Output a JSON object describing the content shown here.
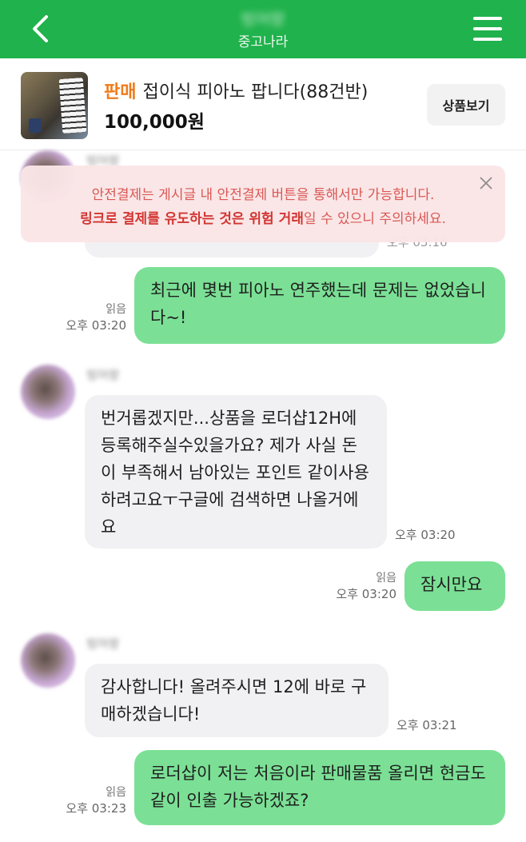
{
  "header": {
    "contact_name": "빙어랑",
    "subtitle": "중고나라"
  },
  "product": {
    "tag": "판매",
    "title": "접이식 피아노 팝니다(88건반)",
    "price": "100,000원",
    "view_button": "상품보기"
  },
  "notice": {
    "line1": "안전결제는 게시글 내 안전결제 버튼을 통해서만 가능합니다.",
    "line2_bold": "링크로 결제를 유도하는 것은 위험 거래",
    "line2_rest": "일 수 있으니 주의하세요."
  },
  "messages": [
    {
      "direction": "out",
      "text": "최근에 몇번 피아노 연주했는데 문제는 없었습니다~!",
      "read_label": "읽음",
      "time": "오후 03:20"
    },
    {
      "direction": "in",
      "sender": "빙어랑",
      "text": "번거롭겠지만...상품을 로더샵12H에 등록해주실수있을가요? 제가 사실 돈이 부족해서 남아있는 포인트 같이사용하려고요ㅜ구글에 검색하면 나올거에요",
      "time": "오후 03:20"
    },
    {
      "direction": "out",
      "text": "잠시만요",
      "read_label": "읽음",
      "time": "오후 03:20"
    },
    {
      "direction": "in",
      "sender": "빙어랑",
      "text": "감사합니다! 올려주시면 12에 바로 구매하겠습니다!",
      "time": "오후 03:21"
    },
    {
      "direction": "out",
      "text": "로더샵이 저는 처음이라 판매물품 올리면 현금도 같이 인출 가능하겠죠?",
      "read_label": "읽음",
      "time": "오후 03:23"
    }
  ],
  "hidden_message": {
    "time": "오후 03:16"
  },
  "colors": {
    "header_green": "#20b24c",
    "outgoing_bubble": "#7be095",
    "incoming_bubble": "#f1f1f3",
    "sale_orange": "#f07c1a",
    "notice_red": "#d9524e"
  },
  "icons": {
    "back": "chevron-left-icon",
    "menu": "hamburger-menu-icon",
    "notice_close": "close-icon"
  }
}
